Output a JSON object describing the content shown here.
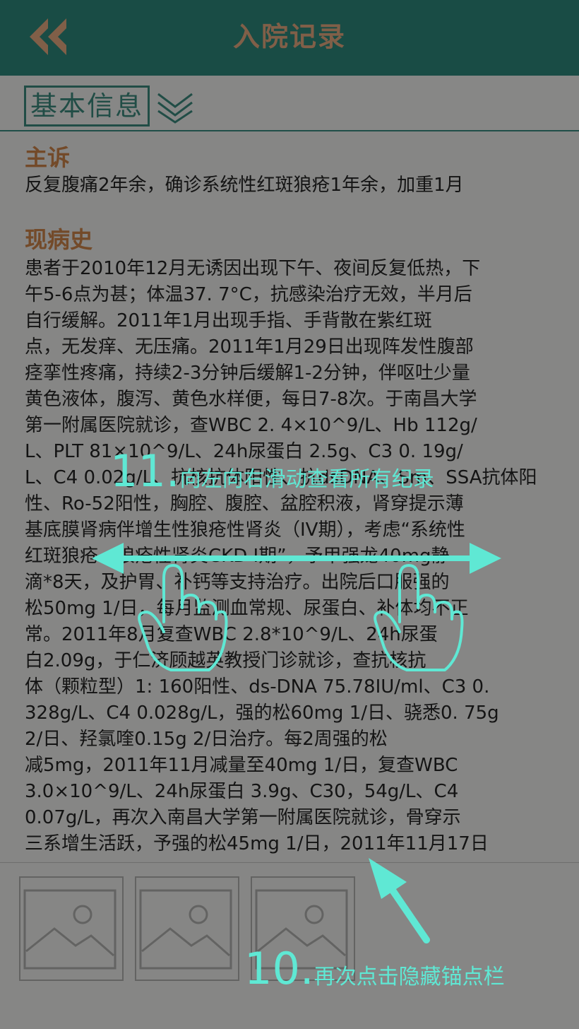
{
  "header": {
    "title": "入院记录",
    "back_icon": "double-chevron-left-icon"
  },
  "tabbar": {
    "tab_label": "基本信息",
    "expand_icon": "double-chevron-down-icon"
  },
  "record": {
    "chief_complaint_label": "主诉",
    "chief_complaint": "反复腹痛2年余，确诊系统性红斑狼疮1年余，加重1月",
    "history_label": "现病史",
    "history": "患者于2010年12月无诱因出现下午、夜间反复低热，下\n午5-6点为甚；体温37. 7°C，抗感染治疗无效，半月后\n自行缓解。2011年1月出现手指、手背散在紫红斑\n点，无发痒、无压痛。2011年1月29日出现阵发性腹部\n痉挛性疼痛，持续2-3分钟后缓解1-2分钟，伴呕吐少量\n黄色液体，腹泻、黄色水样便，每日7-8次。于南昌大学\n第一附属医院就诊，查WBC 2. 4×10^9/L、Hb 112g/\nL、PLT 81×10^9/L、24h尿蛋白 2.5g、C3 0. 19g/\nL、C4 0.02g/L、抗核抗体阳性、抗dsDNA、Sm、SSA抗体阳\n性、Ro-52阳性，胸腔、腹腔、盆腔积液，肾穿提示薄\n基底膜肾病伴增生性狼疮性肾炎（IV期），考虑“系统性\n红斑狼疮、狼疮性肾炎CKD I期”，予甲强龙40mg静\n滴*8天，及护胃、补钙等支持治疗。出院后口服强的\n松50mg 1/日，每月监测血常规、尿蛋白、补体均不正\n常。2011年8月复查WBC 2.8*10^9/L、24h尿蛋\n白2.09g，于仁济顾越英教授门诊就诊，查抗核抗\n体（颗粒型）1: 160阳性、ds-DNA 75.78IU/ml、C3 0.\n328g/L、C4 0.028g/L，强的松60mg 1/日、骁悉0. 75g\n2/日、羟氯喹0.15g 2/日治疗。每2周强的松\n减5mg，2011年11月减量至40mg 1/日，复查WBC\n3.0×10^9/L、24h尿蛋白 3.9g、C30，54g/L、C4\n0.07g/L，再次入南昌大学第一附属医院就诊，骨穿示\n三系增生活跃，予强的松45mg 1/日，2011年11月17日"
  },
  "thumbnails": [
    {
      "icon": "image-placeholder-icon"
    },
    {
      "icon": "image-placeholder-icon"
    },
    {
      "icon": "image-placeholder-icon"
    }
  ],
  "annotations": {
    "step11_number": "11.",
    "step11_text": "向左向右滑动查看所有纪录",
    "step10_number": "10.",
    "step10_text": "再次点击隐藏锚点栏",
    "accent_color": "#5fe8d4"
  },
  "colors": {
    "header": "#2f8a7e",
    "title": "#e9ae84",
    "section_label": "#d2874c",
    "tab_border": "#3c8c80"
  }
}
